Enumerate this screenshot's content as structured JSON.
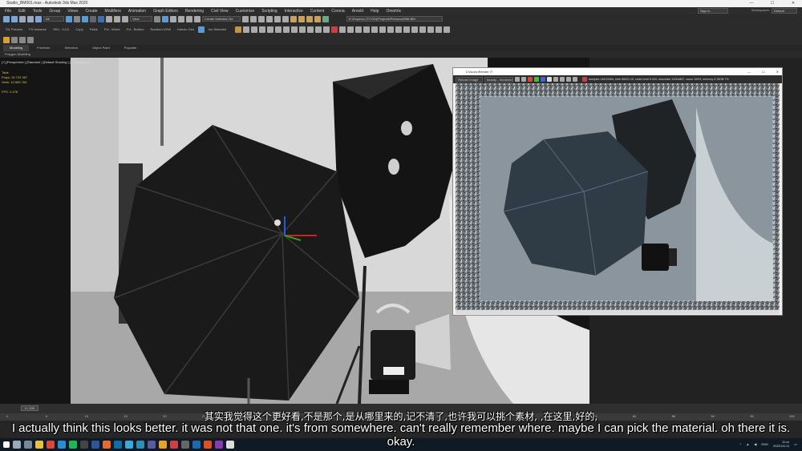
{
  "app": {
    "title": "Studio_BM001.max - Autodesk 3ds Max 2020"
  },
  "menu": [
    "File",
    "Edit",
    "Tools",
    "Group",
    "Views",
    "Create",
    "Modifiers",
    "Animation",
    "Graph Editors",
    "Rendering",
    "Civil View",
    "Customize",
    "Scripting",
    "Interactive",
    "Content",
    "Corona",
    "Arnold",
    "Help",
    "Omnitrix"
  ],
  "header": {
    "sign_in": "Sign In",
    "workspaces_label": "Workspaces:",
    "workspace_value": "Default"
  },
  "toolbar": {
    "filter_value": "All",
    "view_value": "View",
    "selection_set_placeholder": "Create Selection Se",
    "path_text": "E:\\Dropbox (TCOD)\\Projects\\Personal\\Riitt BM",
    "labels": [
      "SIL Preview",
      "FG Instance",
      "OBJ - 0,0,0",
      "Copy",
      "Paste",
      "Pvt - World",
      "Pvt - Bottom",
      "Random UVW",
      "Kanzlo Gen",
      "Iso Selected"
    ]
  },
  "ribbon": {
    "tabs": [
      "Modeling",
      "Freeform",
      "Selection",
      "Object Paint",
      "Populate"
    ],
    "active": 0,
    "sub_label": "Polygon Modeling"
  },
  "viewport": {
    "label": "[+] [Perspective ] [Standard ] [Default Shading ] [ <<Disabled>> ]",
    "stats": {
      "total_label": "Total",
      "polys_label": "Polys:",
      "polys": "16 723 367",
      "verts_label": "Verts:",
      "verts": "10 865 784",
      "fps_label": "FPS:",
      "fps": "2.478"
    }
  },
  "framebuffer": {
    "title": "CVsoronRender IT",
    "render_mode": "Render Image",
    "channel": "beauty - rendered",
    "status": "samples 146/1000s, time #5021:15, noise level 5.043, resolution 1000x667, zoom 100%, memory 5.78GB 7%"
  },
  "timeline": {
    "frame_counter": "0 / 100",
    "ticks": [
      "0",
      "5",
      "10",
      "15",
      "20",
      "25",
      "30",
      "35",
      "40",
      "45",
      "50",
      "55",
      "60",
      "65",
      "70",
      "75",
      "80",
      "85",
      "90",
      "95",
      "100"
    ]
  },
  "taskbar": {
    "lang": "ENG",
    "time": "11:xx",
    "date": "2020-03-11"
  },
  "subtitles": {
    "zh": "其实我觉得这个更好看,不是那个,是从哪里来的,记不清了,也许我可以挑个素材, ,在这里,好的,",
    "en": "I actually think this looks better. it was not that one. it's from somewhere. can't really remember where. maybe I can pick the material. oh there it is. okay."
  },
  "colors": {
    "accent": "#5a9bd5",
    "stats": "#e2c44a",
    "menu_bg": "#2d2d2d",
    "taskbar": "#0f1a24"
  }
}
